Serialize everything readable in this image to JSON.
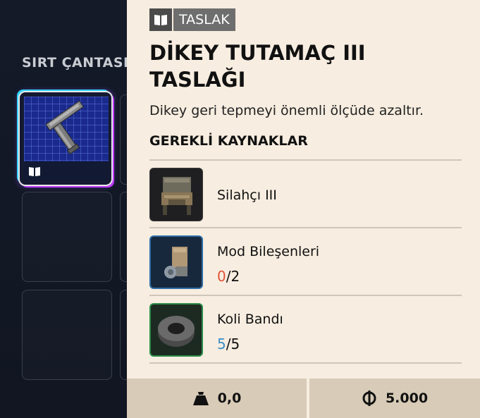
{
  "backpack": {
    "title": "SIRT ÇANTASI"
  },
  "item": {
    "tag_label": "TASLAK",
    "tag_icon": "book-icon",
    "title": "DİKEY TUTAMAÇ III TASLAĞI",
    "description": "Dikey geri tepmeyi önemli ölçüde azaltır."
  },
  "requirements": {
    "title": "GEREKLİ KAYNAKLAR",
    "items": [
      {
        "name": "Silahçı III",
        "icon": "workbench-icon"
      },
      {
        "name": "Mod Bileşenleri",
        "have": "0",
        "need": "/2",
        "icon": "mod-components-icon"
      },
      {
        "name": "Koli Bandı",
        "have": "5",
        "need": "/5",
        "icon": "duct-tape-icon"
      }
    ]
  },
  "footer": {
    "weight": "0,0",
    "weight_icon": "weight-icon",
    "price": "5.000",
    "price_icon": "currency-icon"
  },
  "colors": {
    "panel_bg": "#f7ede0",
    "footer_bg": "#d8cbb7",
    "qty_missing": "#e2523a",
    "qty_ok": "#3a8fc9"
  }
}
